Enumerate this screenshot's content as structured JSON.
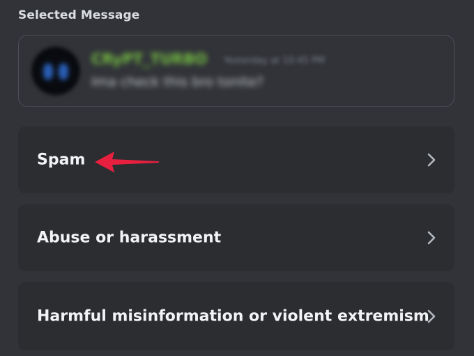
{
  "section": {
    "title": "Selected Message"
  },
  "selected_message": {
    "author": "CRyPT_TURBO",
    "timestamp": "Yesterday at 10:45 PM",
    "text": "Ima check this bro tonite?",
    "author_color": "#76c043"
  },
  "report_reasons": [
    {
      "label": "Spam",
      "icon": "chevron-right-icon"
    },
    {
      "label": "Abuse or harassment",
      "icon": "chevron-right-icon"
    },
    {
      "label": "Harmful misinformation or violent extremism",
      "icon": "chevron-right-icon"
    }
  ],
  "annotation": {
    "icon": "red-arrow-icon",
    "color": "#e8203f"
  },
  "colors": {
    "background": "#313338",
    "option_background": "#2b2d31",
    "text_primary": "#f2f3f5"
  }
}
